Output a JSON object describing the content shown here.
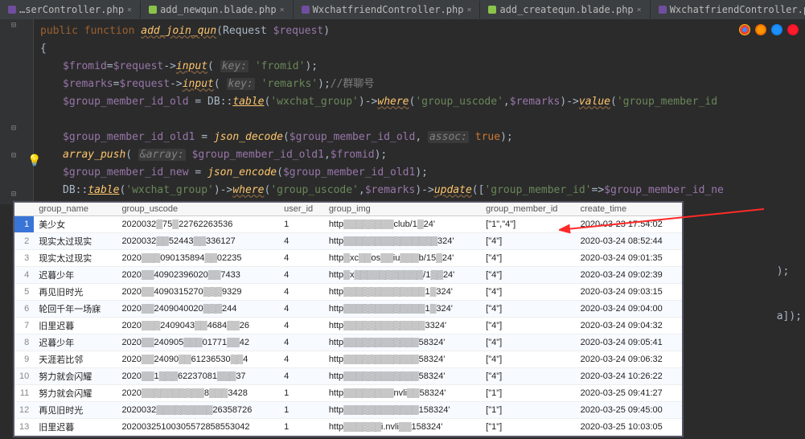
{
  "tabs": [
    {
      "label": "…serController.php",
      "type": "php"
    },
    {
      "label": "add_newqun.blade.php",
      "type": "blade"
    },
    {
      "label": "WxchatfriendController.php",
      "type": "php"
    },
    {
      "label": "add_createqun.blade.php",
      "type": "blade"
    },
    {
      "label": "WxchatfriendController.php",
      "type": "php"
    }
  ],
  "code": {
    "l0": "public function add_join_qun(Request $request)",
    "l1": "{",
    "l2a": "$fromid",
    "l2b": "=",
    "l2c": "$request",
    "l2d": "->",
    "l2e": "input",
    "l2f": "(",
    "l2hint1": "key:",
    "l2g": "'fromid'",
    "l2h": ");",
    "l3a": "$remarks",
    "l3b": "=",
    "l3c": "$request",
    "l3d": "->",
    "l3e": "input",
    "l3f": "(",
    "l3hint1": "key:",
    "l3g": "'remarks'",
    "l3h": ");",
    "l3cmt": "//群聊号",
    "l4a": "$group_member_id_old",
    "l4b": " = ",
    "l4c": "DB",
    "l4d": "::",
    "l4e": "table",
    "l4f": "(",
    "l4g": "'wxchat_group'",
    "l4h": ")->",
    "l4i": "where",
    "l4j": "(",
    "l4k": "'group_uscode'",
    "l4l": ",",
    "l4m": "$remarks",
    "l4n": ")->",
    "l4o": "value",
    "l4p": "(",
    "l4q": "'group_member_id",
    "l5a": "$group_member_id_old1",
    "l5b": " = ",
    "l5c": "json_decode",
    "l5d": "(",
    "l5e": "$group_member_id_old",
    "l5f": ", ",
    "l5hint": "assoc:",
    "l5g": "true",
    "l5h": ");",
    "l6a": "array_push",
    "l6b": "(",
    "l6hint": "&array:",
    "l6c": "$group_member_id_old1",
    "l6d": ",",
    "l6e": "$fromid",
    "l6f": ");",
    "l7a": "$group_member_id_new",
    "l7b": " = ",
    "l7c": "json_encode",
    "l7d": "(",
    "l7e": "$group_member_id_old1",
    "l7f": ");",
    "l8a": "DB",
    "l8b": "::",
    "l8c": "table",
    "l8d": "(",
    "l8e": "'wxchat_group'",
    "l8f": ")->",
    "l8g": "where",
    "l8h": "(",
    "l8i": "'group_uscode'",
    "l8j": ",",
    "l8k": "$remarks",
    "l8l": ")->",
    "l8m": "update",
    "l8n": "([",
    "l8o": "'group_member_id'",
    "l8p": "=>",
    "l8q": "$group_member_id_ne"
  },
  "rightcode": {
    "a": ");",
    "b": "a]);"
  },
  "table": {
    "headers": [
      "",
      "group_name",
      "group_uscode",
      "user_id",
      "group_img",
      "group_member_id",
      "create_time"
    ],
    "rows": [
      [
        "1",
        "美少女",
        "2020032▒75▒22762263536",
        "1",
        "http▒▒▒▒▒▒▒▒club/1▒24'",
        "[\"1\",\"4\"]",
        "2020-03-23 17:54:02"
      ],
      [
        "2",
        "现实太过现实",
        "2020032▒▒52443▒▒336127",
        "4",
        "http▒▒▒▒▒▒▒▒▒▒▒▒▒▒▒324'",
        "[\"4\"]",
        "2020-03-24 08:52:44"
      ],
      [
        "3",
        "现实太过现实",
        "2020▒▒▒090135894▒▒02235",
        "4",
        "http▒xc▒▒os▒▒iu▒▒▒b/15▒24'",
        "[\"4\"]",
        "2020-03-24 09:01:35"
      ],
      [
        "4",
        "迟暮少年",
        "2020▒▒40902396020▒▒7433",
        "4",
        "http▒x▒▒▒▒▒▒▒▒▒▒▒/1▒▒24'",
        "[\"4\"]",
        "2020-03-24 09:02:39"
      ],
      [
        "5",
        "再见旧时光",
        "2020▒▒4090315270▒▒▒9329",
        "4",
        "http▒▒▒▒▒▒▒▒▒▒▒▒▒1▒324'",
        "[\"4\"]",
        "2020-03-24 09:03:15"
      ],
      [
        "6",
        "轮回千年一场寐",
        "2020▒▒2409040020▒▒▒244",
        "4",
        "http▒▒▒▒▒▒▒▒▒▒▒▒▒1▒324'",
        "[\"4\"]",
        "2020-03-24 09:04:00"
      ],
      [
        "7",
        "旧里迟暮",
        "2020▒▒▒2409043▒▒4684▒▒26",
        "4",
        "http▒▒▒▒▒▒▒▒▒▒▒▒▒3324'",
        "[\"4\"]",
        "2020-03-24 09:04:32"
      ],
      [
        "8",
        "迟暮少年",
        "2020▒▒240905▒▒▒01771▒▒42",
        "4",
        "http▒▒▒▒▒▒▒▒▒▒▒▒58324'",
        "[\"4\"]",
        "2020-03-24 09:05:41"
      ],
      [
        "9",
        "天涯若比邻",
        "2020▒▒24090▒▒61236530▒▒4",
        "4",
        "http▒▒▒▒▒▒▒▒▒▒▒▒58324'",
        "[\"4\"]",
        "2020-03-24 09:06:32"
      ],
      [
        "10",
        "努力就会闪耀",
        "2020▒▒1▒▒▒62237081▒▒▒37",
        "4",
        "http▒▒▒▒▒▒▒▒▒▒▒▒58324'",
        "[\"4\"]",
        "2020-03-24 10:26:22"
      ],
      [
        "11",
        "努力就会闪耀",
        "2020▒▒▒▒▒▒▒▒▒▒8▒▒▒3428",
        "1",
        "http▒▒▒▒▒▒▒▒nvli▒▒58324'",
        "[\"1\"]",
        "2020-03-25 09:41:27"
      ],
      [
        "12",
        "再见旧时光",
        "2020032▒▒▒▒▒▒▒▒▒26358726",
        "1",
        "http▒▒▒▒▒▒▒▒▒▒▒▒158324'",
        "[\"1\"]",
        "2020-03-25 09:45:00"
      ],
      [
        "13",
        "旧里迟暮",
        "20200325100305572858553042",
        "1",
        "http▒▒▒▒▒▒i.nvli▒▒158324'",
        "[\"1\"]",
        "2020-03-25 10:03:05"
      ]
    ]
  }
}
